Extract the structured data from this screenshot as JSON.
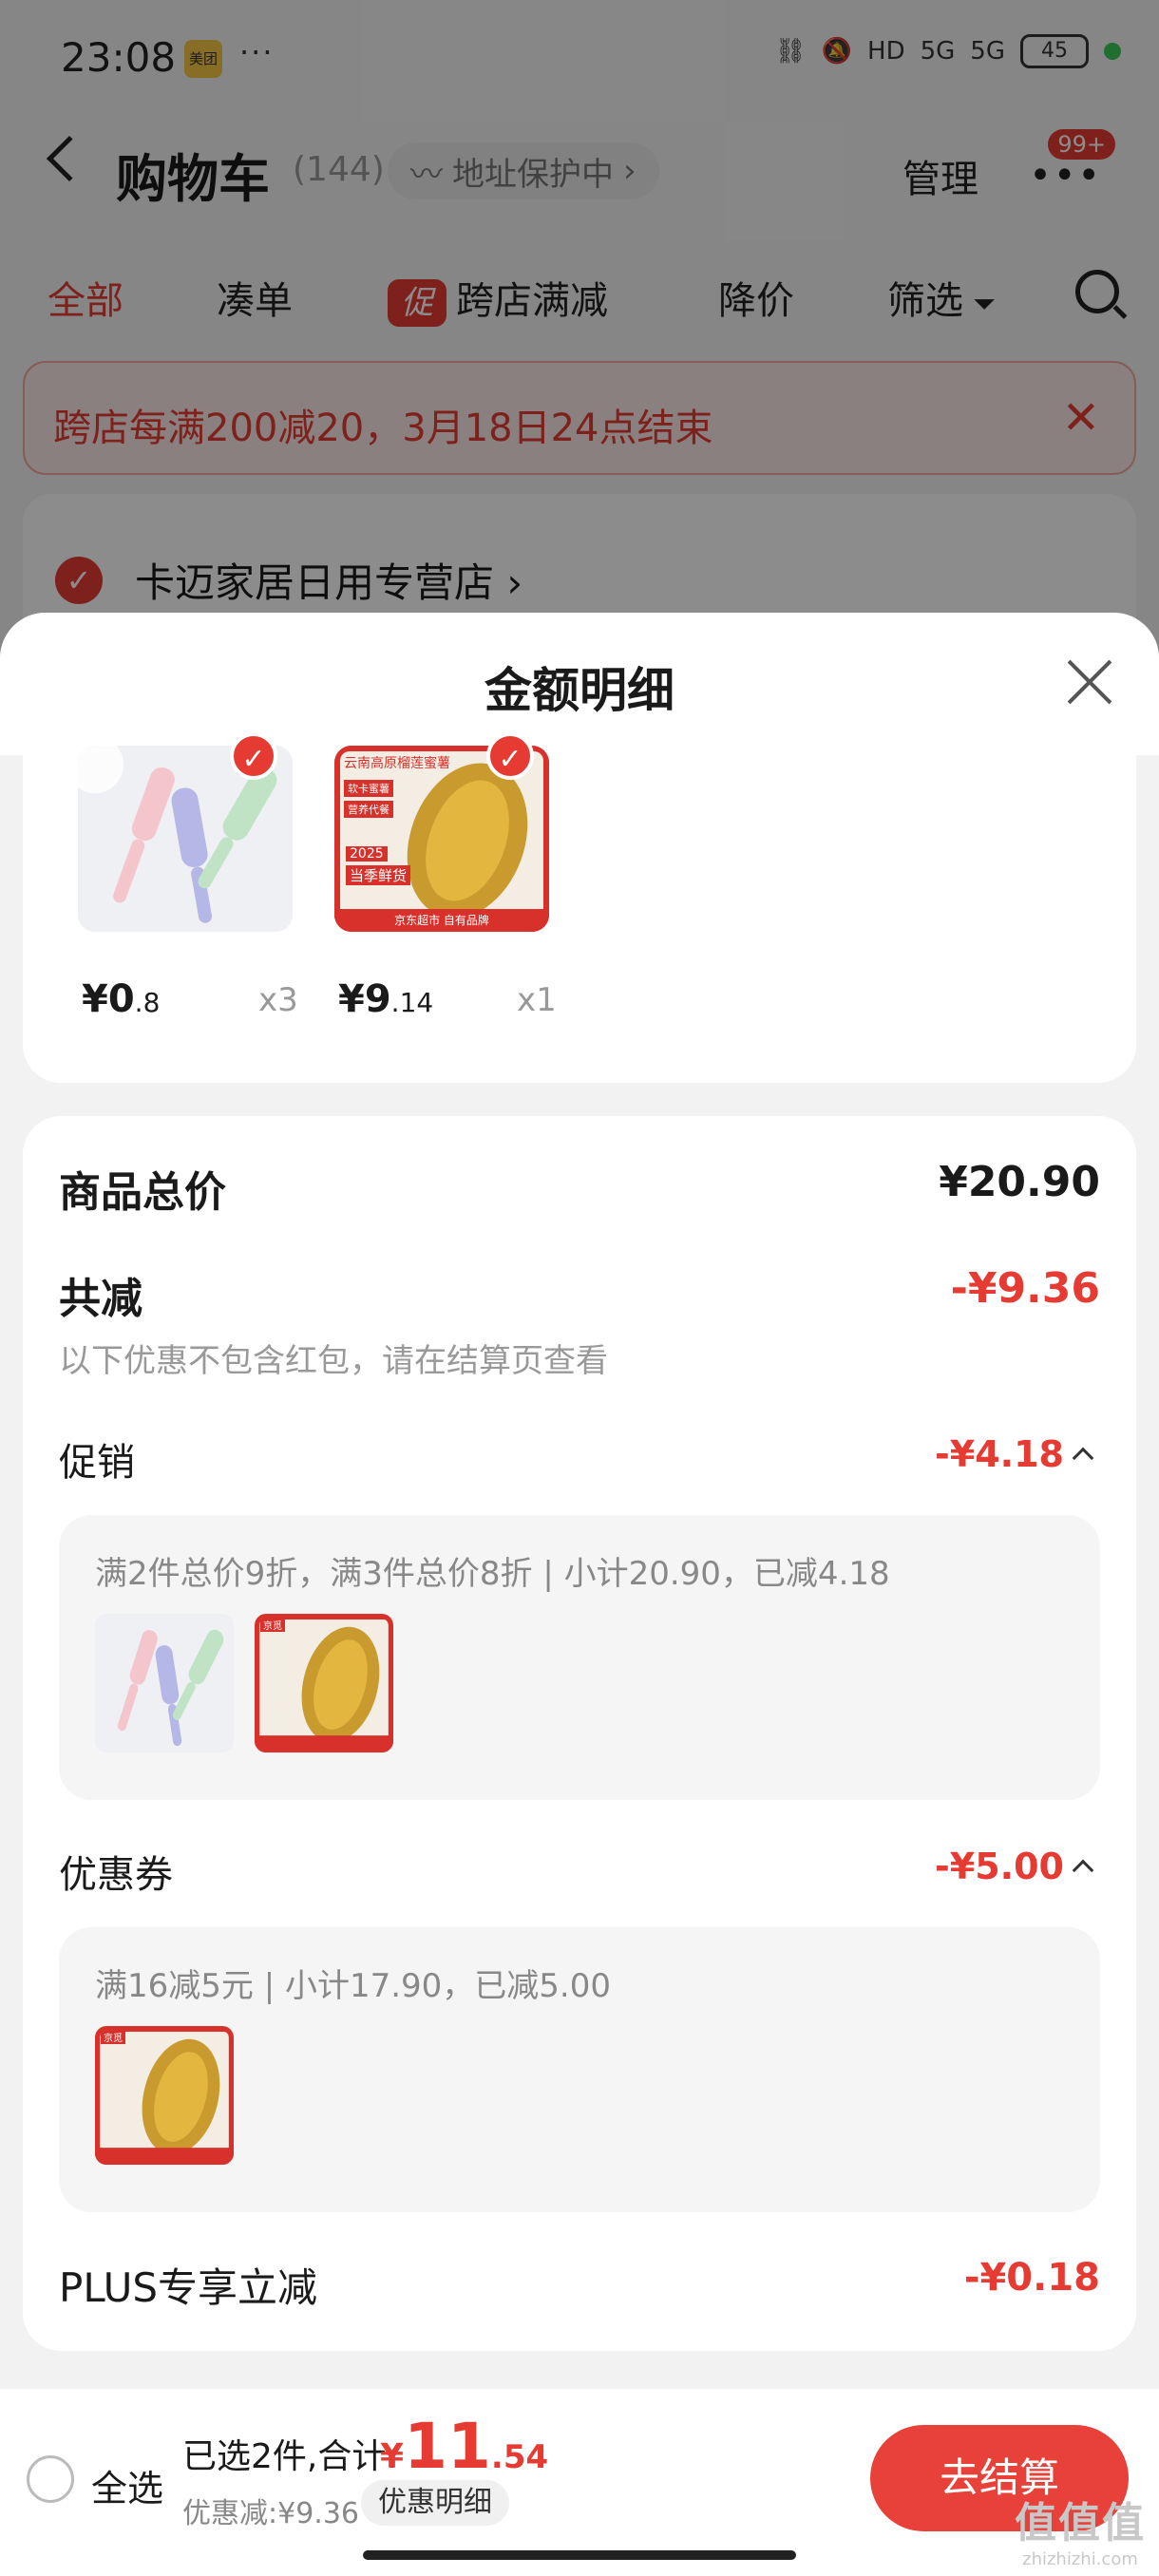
{
  "status_bar": {
    "time": "23:08",
    "app_badge": "美团",
    "more": "···",
    "network": "5G",
    "hd": "HD",
    "battery": "45"
  },
  "nav": {
    "title": "购物车",
    "count": "(144)",
    "address_protect": "地址保护中",
    "manage": "管理",
    "notification_badge": "99+"
  },
  "filters": {
    "all": "全部",
    "bundle": "凑单",
    "promo_tag": "促",
    "cross_store": "跨店满减",
    "price_drop": "降价",
    "filter": "筛选"
  },
  "promo_banner": {
    "text": "跨店每满200减20，3月18日24点结束"
  },
  "store": {
    "name": "卡迈家居日用专营店"
  },
  "sheet": {
    "title": "金额明细",
    "products": [
      {
        "price_int": "¥0",
        "price_dec": ".8",
        "qty": "x3",
        "icon": "hair-brush-product-image"
      },
      {
        "price_int": "¥9",
        "price_dec": ".14",
        "qty": "x1",
        "icon": "sweet-potato-product-image"
      }
    ],
    "product_image_texts": {
      "potato_title": "云南高原榴莲蜜薯",
      "potato_tag1": "软卡蜜薯",
      "potato_tag2": "营养代餐",
      "potato_year": "2025",
      "potato_season": "当季鲜货",
      "potato_footer": "京东超市 自有品牌",
      "jd_logo": "京觅"
    },
    "total_label": "商品总价",
    "total_value": "¥20.90",
    "reduce_label": "共减",
    "reduce_value": "-¥9.36",
    "reduce_note": "以下优惠不包含红包，请在结算页查看",
    "promo_label": "促销",
    "promo_value": "-¥4.18",
    "promo_detail": "满2件总价9折，满3件总价8折 | 小计20.90，已减4.18",
    "coupon_label": "优惠券",
    "coupon_value": "-¥5.00",
    "coupon_detail": "满16减5元 | 小计17.90，已减5.00",
    "plus_label": "PLUS专享立减",
    "plus_value": "-¥0.18"
  },
  "bottom": {
    "select_all": "全选",
    "selected_text": "已选2件,合计:",
    "total_yen": "¥",
    "total_big": "11",
    "total_cents": ".54",
    "discount": "优惠减:¥9.36",
    "detail_pill": "优惠明细",
    "checkout": "去结算"
  },
  "watermark": {
    "main": "值值值",
    "sub": "zhizhizhi.com"
  },
  "colors": {
    "accent": "#e53b32",
    "sheet_bg": "#f2f2f2",
    "card_bg": "#ffffff"
  }
}
